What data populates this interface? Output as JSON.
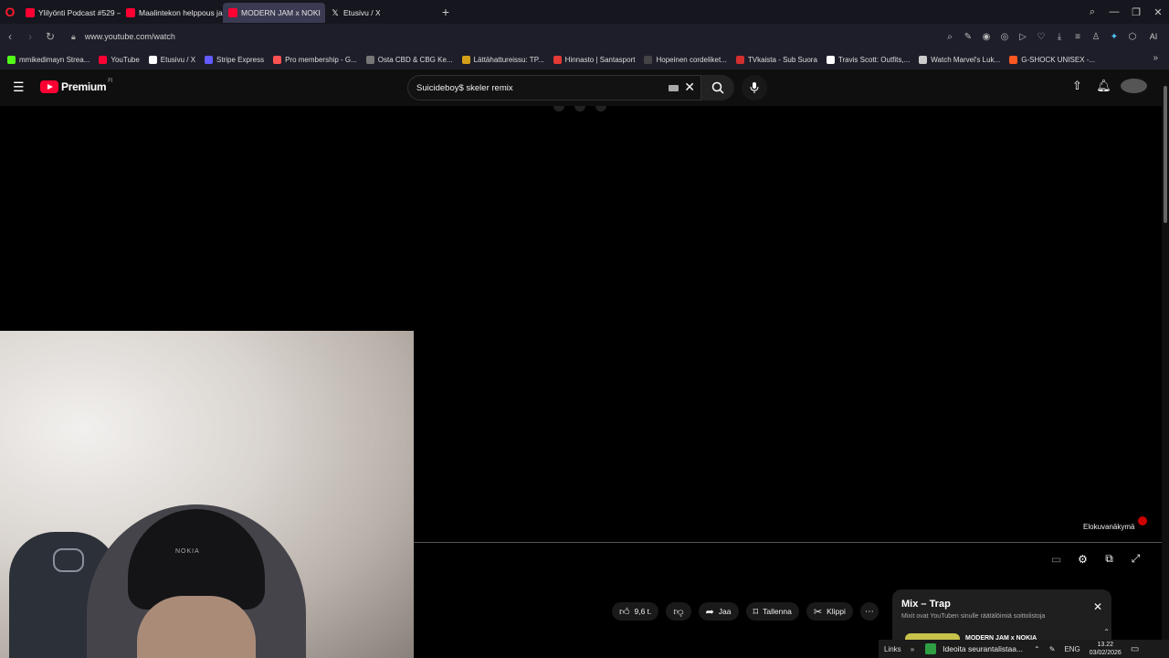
{
  "browser": {
    "tabs": [
      {
        "label": "Ylilyönti Podcast #529 – U",
        "icon": "youtube-icon",
        "active": false
      },
      {
        "label": "Maalintekon helppous ja m",
        "icon": "youtube-icon",
        "active": false
      },
      {
        "label": "MODERN JAM x NOKI",
        "icon": "youtube-icon",
        "active": true
      },
      {
        "label": "Etusivu / X",
        "icon": "x-icon",
        "active": false
      }
    ],
    "url": "www.youtube.com/watch",
    "ai_label": "AI"
  },
  "bookmarks": [
    {
      "label": "mmikedimayn Strea...",
      "color": "#53fc18"
    },
    {
      "label": "YouTube",
      "color": "#ff0033"
    },
    {
      "label": "Etusivu / X",
      "color": "#ffffff"
    },
    {
      "label": "Stripe Express",
      "color": "#635bff"
    },
    {
      "label": "Pro membership - G...",
      "color": "#ff5252"
    },
    {
      "label": "Osta CBD & CBG Ke...",
      "color": "#777777"
    },
    {
      "label": "Lättähattureissu: TP...",
      "color": "#d4a017"
    },
    {
      "label": "Hinnasto | Santasport",
      "color": "#e53935"
    },
    {
      "label": "Hopeinen cordeliket...",
      "color": "#444444"
    },
    {
      "label": "TVkaista - Sub Suora",
      "color": "#d32f2f"
    },
    {
      "label": "Travis Scott: Outfits,...",
      "color": "#ffffff"
    },
    {
      "label": "Watch Marvel's Luk...",
      "color": "#cccccc"
    },
    {
      "label": "G-SHOCK UNISEX -...",
      "color": "#ff5722"
    }
  ],
  "youtube": {
    "brand": "Premium",
    "region": "FI",
    "search_query": "Suicideboy$ skeler remix"
  },
  "player": {
    "autoplay_label": "Elokuvanäkymä"
  },
  "actions": {
    "like_count": "9,6 t.",
    "share": "Jaa",
    "save": "Tallenna",
    "clip": "Klippi"
  },
  "mix": {
    "title": "Mix – Trap",
    "subtitle": "Mixit ovat YouTuben sinulle räätälöimiä soittolistoja",
    "item_title": "MODERN JAM x NOKIA"
  },
  "webcam": {
    "cap_text": "NOKIA"
  },
  "taskbar": {
    "links": "Links",
    "app": "Ideoita seurantalistaa...",
    "lang": "ENG",
    "time": "13.22",
    "date": "03/02/2026"
  }
}
